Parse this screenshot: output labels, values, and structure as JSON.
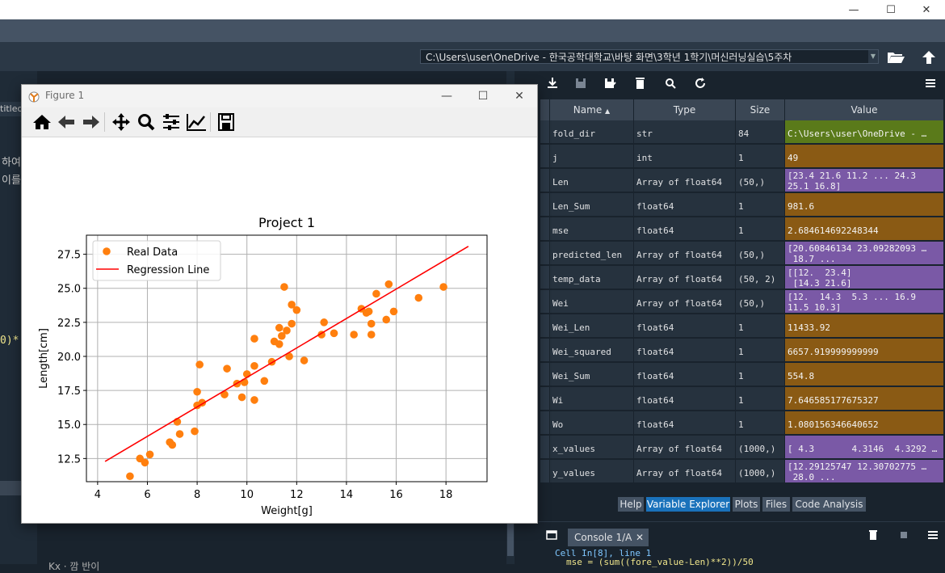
{
  "window": {
    "minimize": "—",
    "maximize": "☐",
    "close": "✕"
  },
  "toolbar": {
    "path": "C:\\Users\\user\\OneDrive - 한국공학대학교\\바탕 화면\\3학년 1학기\\머신러닝실습\\5주차"
  },
  "editor": {
    "tab_fragment": "titled",
    "frag_line1": "하여",
    "frag_line2": "이를",
    "frag_code": "0)*",
    "bottom_text": "Kx                    ·                   깜 반이"
  },
  "figure": {
    "title": "Figure 1",
    "minimize": "—",
    "maximize": "☐",
    "close": "✕"
  },
  "chart_data": {
    "type": "scatter",
    "title": "Project 1",
    "xlabel": "Weight[g]",
    "ylabel": "Length[cm]",
    "xlim": [
      3.55,
      19.65
    ],
    "ylim": [
      10.8,
      28.9
    ],
    "xticks": [
      4,
      6,
      8,
      10,
      12,
      14,
      16,
      18
    ],
    "yticks": [
      12.5,
      15.0,
      17.5,
      20.0,
      22.5,
      25.0,
      27.5
    ],
    "xtick_labels": [
      "4",
      "6",
      "8",
      "10",
      "12",
      "14",
      "16",
      "18"
    ],
    "ytick_labels": [
      "12.5",
      "15.0",
      "17.5",
      "20.0",
      "22.5",
      "25.0",
      "27.5"
    ],
    "grid": true,
    "legend_position": "upper-left",
    "colors": {
      "points": "#ff7f0e",
      "line": "#ff0000"
    },
    "series": [
      {
        "name": "Real Data",
        "kind": "scatter",
        "points": [
          [
            5.3,
            11.2
          ],
          [
            5.7,
            12.5
          ],
          [
            5.9,
            12.2
          ],
          [
            6.1,
            12.8
          ],
          [
            6.9,
            13.7
          ],
          [
            7.0,
            13.5
          ],
          [
            7.2,
            15.2
          ],
          [
            7.3,
            14.3
          ],
          [
            7.9,
            14.5
          ],
          [
            8.0,
            16.4
          ],
          [
            8.0,
            17.4
          ],
          [
            8.1,
            19.4
          ],
          [
            8.2,
            16.6
          ],
          [
            9.1,
            17.2
          ],
          [
            9.2,
            19.1
          ],
          [
            9.6,
            18.0
          ],
          [
            9.8,
            17.0
          ],
          [
            9.9,
            18.1
          ],
          [
            10.0,
            18.7
          ],
          [
            10.3,
            19.3
          ],
          [
            10.3,
            21.3
          ],
          [
            10.3,
            16.8
          ],
          [
            10.7,
            18.2
          ],
          [
            11.0,
            19.6
          ],
          [
            11.1,
            21.1
          ],
          [
            11.3,
            22.1
          ],
          [
            11.3,
            20.9
          ],
          [
            11.4,
            21.5
          ],
          [
            11.5,
            25.1
          ],
          [
            11.6,
            21.9
          ],
          [
            11.7,
            20.0
          ],
          [
            11.8,
            23.8
          ],
          [
            11.8,
            22.4
          ],
          [
            12.0,
            23.4
          ],
          [
            12.3,
            19.7
          ],
          [
            13.0,
            21.6
          ],
          [
            13.1,
            22.5
          ],
          [
            13.5,
            21.7
          ],
          [
            14.3,
            21.6
          ],
          [
            14.6,
            23.5
          ],
          [
            14.8,
            23.2
          ],
          [
            14.9,
            23.3
          ],
          [
            15.0,
            21.6
          ],
          [
            15.0,
            22.4
          ],
          [
            15.2,
            24.6
          ],
          [
            15.6,
            22.7
          ],
          [
            15.7,
            25.3
          ],
          [
            15.9,
            23.3
          ],
          [
            16.9,
            24.3
          ],
          [
            17.9,
            25.1
          ]
        ]
      },
      {
        "name": "Regression Line",
        "kind": "line",
        "points": [
          [
            4.3,
            12.29
          ],
          [
            18.9,
            28.08
          ]
        ]
      }
    ]
  },
  "explorer": {
    "headers": {
      "name": "Name",
      "type": "Type",
      "size": "Size",
      "value": "Value"
    },
    "rows": [
      {
        "name": "fold_dir",
        "type": "str",
        "size": "84",
        "value": "C:\\Users\\user\\OneDrive - …",
        "color": "#5a7a1a"
      },
      {
        "name": "j",
        "type": "int",
        "size": "1",
        "value": "49",
        "color": "#8a5a14"
      },
      {
        "name": "Len",
        "type": "Array of float64",
        "size": "(50,)",
        "value": "[23.4 21.6 11.2 ... 24.3\n25.1 16.8]",
        "color": "#7a59a6"
      },
      {
        "name": "Len_Sum",
        "type": "float64",
        "size": "1",
        "value": "981.6",
        "color": "#8a5a14"
      },
      {
        "name": "mse",
        "type": "float64",
        "size": "1",
        "value": "2.684614692248344",
        "color": "#8a5a14"
      },
      {
        "name": "predicted_len",
        "type": "Array of float64",
        "size": "(50,)",
        "value": "[20.60846134 23.09282093 …\n 18.7 ...",
        "color": "#7a59a6"
      },
      {
        "name": "temp_data",
        "type": "Array of float64",
        "size": "(50, 2)",
        "value": "[[12.  23.4]\n [14.3 21.6]",
        "color": "#7a59a6"
      },
      {
        "name": "Wei",
        "type": "Array of float64",
        "size": "(50,)",
        "value": "[12.  14.3  5.3 ... 16.9\n11.5 10.3]",
        "color": "#7a59a6"
      },
      {
        "name": "Wei_Len",
        "type": "float64",
        "size": "1",
        "value": "11433.92",
        "color": "#8a5a14"
      },
      {
        "name": "Wei_squared",
        "type": "float64",
        "size": "1",
        "value": "6657.919999999999",
        "color": "#8a5a14"
      },
      {
        "name": "Wei_Sum",
        "type": "float64",
        "size": "1",
        "value": "554.8",
        "color": "#8a5a14"
      },
      {
        "name": "Wi",
        "type": "float64",
        "size": "1",
        "value": "7.646585177675327",
        "color": "#8a5a14"
      },
      {
        "name": "Wo",
        "type": "float64",
        "size": "1",
        "value": "1.080156346640652",
        "color": "#8a5a14"
      },
      {
        "name": "x_values",
        "type": "Array of float64",
        "size": "(1000,)",
        "value": "[ 4.3       4.3146  4.3292 …",
        "color": "#7a59a6"
      },
      {
        "name": "y_values",
        "type": "Array of float64",
        "size": "(1000,)",
        "value": "[12.29125747 12.30702775 …\n 28.0 ...",
        "color": "#7a59a6"
      }
    ],
    "tabs": [
      "Help",
      "Variable Explorer",
      "Plots",
      "Files",
      "Code Analysis"
    ],
    "active_tab": "Variable Explorer"
  },
  "console": {
    "tab_label": "Console 1/A",
    "close": "✕",
    "line1": "Cell In[8], line 1",
    "line2": "mse = (sum((fore_value-Len)**2))/50"
  }
}
